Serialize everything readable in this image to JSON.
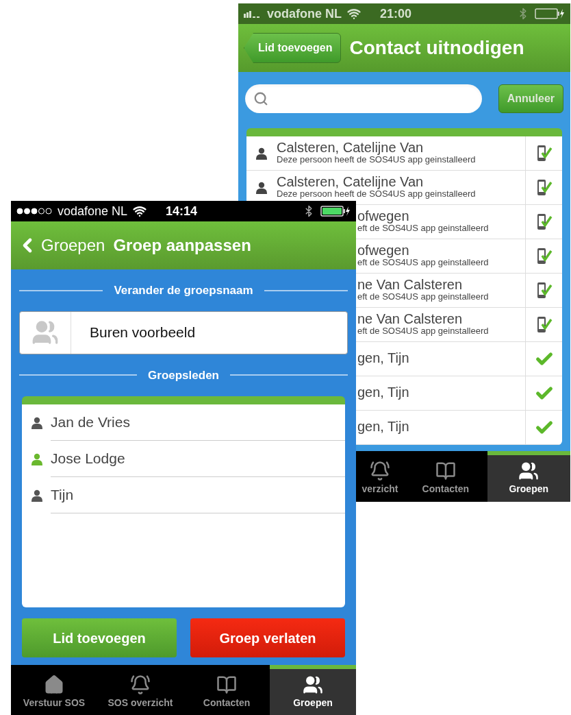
{
  "back_screen": {
    "status_bar": {
      "carrier": "vodafone NL",
      "time": "21:00"
    },
    "nav": {
      "back": "Lid toevoegen",
      "title": "Contact uitnodigen"
    },
    "search": {
      "cancel": "Annuleer"
    },
    "contacts": [
      {
        "name": "Calsteren, Catelijne Van",
        "subtitle": "Deze persoon heeft de SOS4US app geinstalleerd",
        "kind": "app"
      },
      {
        "name": "Calsteren, Catelijne Van",
        "subtitle": "Deze persoon heeft de SOS4US app geinstalleerd",
        "kind": "app"
      },
      {
        "name": "ofwegen",
        "subtitle": "eft de SOS4US app geinstalleerd",
        "kind": "app"
      },
      {
        "name": "ofwegen",
        "subtitle": "eft de SOS4US app geinstalleerd",
        "kind": "app"
      },
      {
        "name": "ne Van Calsteren",
        "subtitle": "eft de SOS4US app geinstalleerd",
        "kind": "app"
      },
      {
        "name": "ne Van Calsteren",
        "subtitle": "eft de SOS4US app geinstalleerd",
        "kind": "app"
      },
      {
        "name": "gen, Tijn",
        "kind": "selected"
      },
      {
        "name": "gen, Tijn",
        "kind": "selected"
      },
      {
        "name": "gen, Tijn",
        "kind": "selected"
      }
    ],
    "tab_bar": [
      {
        "label": "verzicht",
        "selected": false
      },
      {
        "label": "Contacten",
        "selected": false
      },
      {
        "label": "Groepen",
        "selected": true
      }
    ]
  },
  "front_screen": {
    "status_bar": {
      "carrier": "vodafone NL",
      "time": "14:14"
    },
    "nav": {
      "back": "Groepen",
      "title": "Groep aanpassen"
    },
    "name_section": {
      "heading": "Verander de groepsnaam",
      "value": "Buren voorbeeld"
    },
    "members_section": {
      "heading": "Groepsleden",
      "members": [
        {
          "name": "Jan de Vries",
          "color": "#555555"
        },
        {
          "name": "Jose Lodge",
          "color": "#6ab82e"
        },
        {
          "name": "Tijn",
          "color": "#555555"
        }
      ]
    },
    "buttons": {
      "add": "Lid toevoegen",
      "leave": "Groep verlaten"
    },
    "tab_bar": [
      {
        "label": "Verstuur SOS",
        "selected": false
      },
      {
        "label": "SOS overzicht",
        "selected": false
      },
      {
        "label": "Contacten",
        "selected": false
      },
      {
        "label": "Groepen",
        "selected": true
      }
    ]
  }
}
